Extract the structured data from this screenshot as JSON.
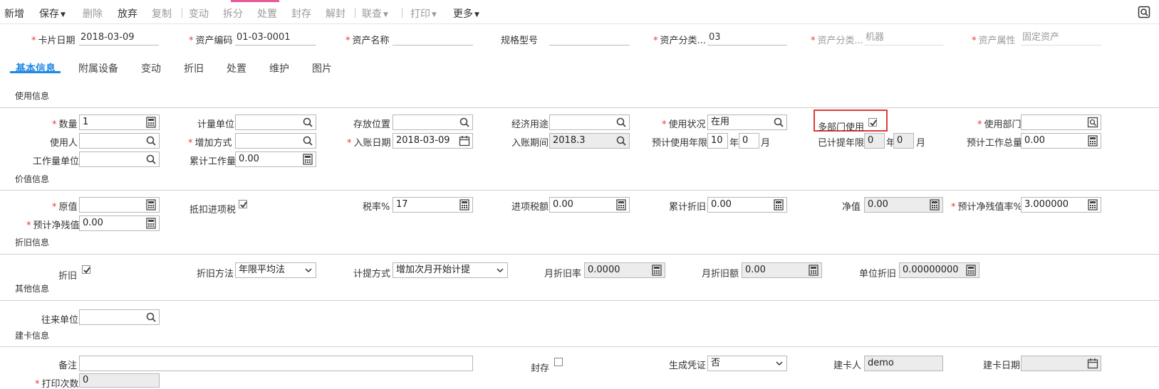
{
  "toolbar": {
    "new": "新增",
    "save": "保存",
    "delete": "删除",
    "abandon": "放弃",
    "copy": "复制",
    "change": "变动",
    "split": "拆分",
    "dispose": "处置",
    "seal": "封存",
    "unseal": "解封",
    "query": "联查",
    "print": "打印",
    "more": "更多"
  },
  "header": {
    "card_date": {
      "label": "卡片日期",
      "value": "2018-03-09"
    },
    "asset_code": {
      "label": "资产编码",
      "value": "01-03-0001"
    },
    "asset_name": {
      "label": "资产名称",
      "value": ""
    },
    "spec": {
      "label": "规格型号",
      "value": ""
    },
    "category": {
      "label": "资产分类...",
      "value": "03"
    },
    "category_name": {
      "label": "资产分类...",
      "value": "机器"
    },
    "attribute": {
      "label": "资产属性",
      "value": "固定资产"
    }
  },
  "tabs": [
    "基本信息",
    "附属设备",
    "变动",
    "折旧",
    "处置",
    "维护",
    "图片"
  ],
  "sections": {
    "usage": "使用信息",
    "value": "价值信息",
    "depreciation": "折旧信息",
    "other": "其他信息",
    "card": "建卡信息"
  },
  "usage": {
    "quantity": {
      "label": "数量",
      "value": "1"
    },
    "unit": {
      "label": "计量单位",
      "value": ""
    },
    "location": {
      "label": "存放位置",
      "value": ""
    },
    "purpose": {
      "label": "经济用途",
      "value": ""
    },
    "status": {
      "label": "使用状况",
      "value": "在用"
    },
    "multi_dept": {
      "label": "多部门使用",
      "checked": true
    },
    "dept": {
      "label": "使用部门",
      "value": ""
    },
    "user": {
      "label": "使用人",
      "value": ""
    },
    "add_method": {
      "label": "增加方式",
      "value": ""
    },
    "entry_date": {
      "label": "入账日期",
      "value": "2018-03-09"
    },
    "entry_period": {
      "label": "入账期间",
      "value": "2018.3"
    },
    "life": {
      "label": "预计使用年限",
      "years": "10",
      "months": "0",
      "year_unit": "年",
      "month_unit": "月"
    },
    "used_life": {
      "label": "已计提年限",
      "years": "0",
      "months": "0",
      "year_unit": "年",
      "month_unit": "月"
    },
    "total_work": {
      "label": "预计工作总量",
      "value": "0.00"
    },
    "work_unit": {
      "label": "工作量单位",
      "value": ""
    },
    "acc_work": {
      "label": "累计工作量",
      "value": "0.00"
    }
  },
  "value": {
    "original": {
      "label": "原值",
      "value": ""
    },
    "deduct_tax": {
      "label": "抵扣进项税",
      "checked": true
    },
    "tax_rate": {
      "label": "税率%",
      "value": "17"
    },
    "input_tax": {
      "label": "进项税额",
      "value": "0.00"
    },
    "acc_dep": {
      "label": "累计折旧",
      "value": "0.00"
    },
    "net": {
      "label": "净值",
      "value": "0.00"
    },
    "residual_rate": {
      "label": "预计净残值率%",
      "value": "3.000000"
    },
    "residual": {
      "label": "预计净残值",
      "value": "0.00"
    }
  },
  "depreciation": {
    "dep": {
      "label": "折旧",
      "checked": true
    },
    "method": {
      "label": "折旧方法",
      "value": "年限平均法"
    },
    "accrual": {
      "label": "计提方式",
      "value": "增加次月开始计提"
    },
    "monthly_rate": {
      "label": "月折旧率",
      "value": "0.0000"
    },
    "monthly_amount": {
      "label": "月折旧额",
      "value": "0.00"
    },
    "unit_dep": {
      "label": "单位折旧",
      "value": "0.00000000"
    }
  },
  "other": {
    "partner": {
      "label": "往来单位",
      "value": ""
    }
  },
  "card": {
    "remark": {
      "label": "备注",
      "value": ""
    },
    "sealed": {
      "label": "封存",
      "checked": false
    },
    "voucher": {
      "label": "生成凭证",
      "value": "否"
    },
    "creator": {
      "label": "建卡人",
      "value": "demo"
    },
    "create_date": {
      "label": "建卡日期",
      "value": ""
    },
    "print_count": {
      "label": "打印次数",
      "value": "0"
    }
  },
  "colors": {
    "accent": "#1e88e5",
    "required": "#e53935",
    "highlight": "#e03a3a",
    "readonly_bg": "#ececec"
  }
}
